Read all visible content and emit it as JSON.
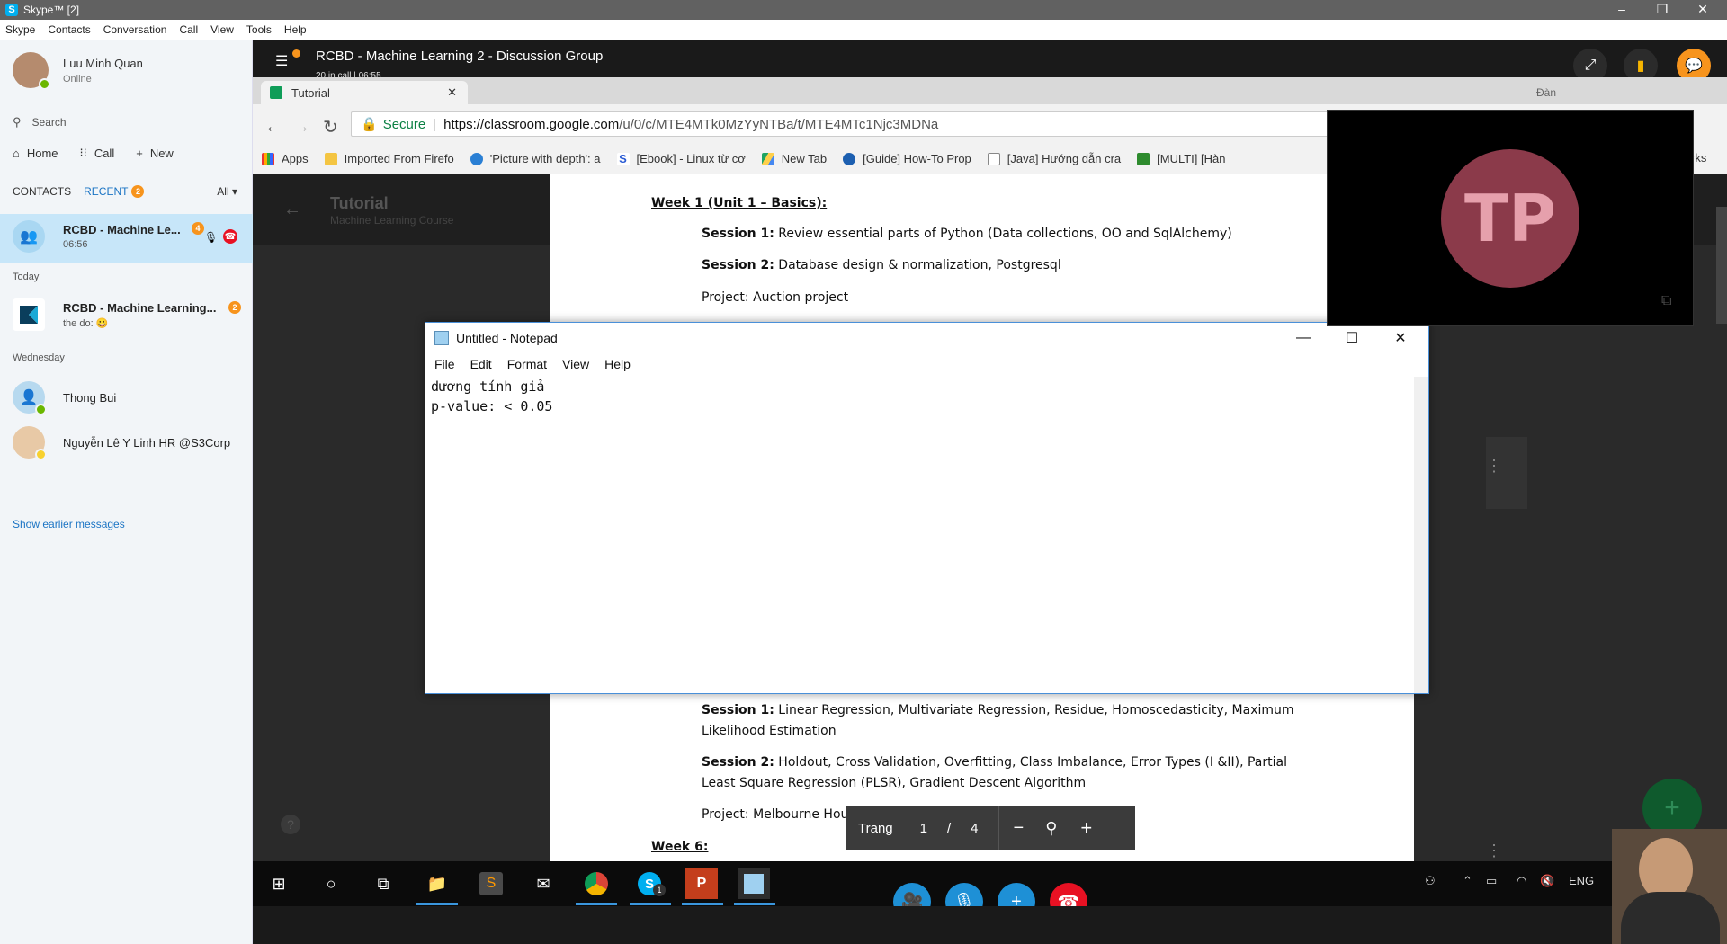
{
  "skype_window": {
    "title": "Skype™ [2]",
    "menu": [
      "Skype",
      "Contacts",
      "Conversation",
      "Call",
      "View",
      "Tools",
      "Help"
    ]
  },
  "profile": {
    "name": "Luu Minh Quan",
    "status": "Online"
  },
  "search": {
    "placeholder": "Search"
  },
  "nav": {
    "home": "Home",
    "call": "Call",
    "new": "New"
  },
  "list_tabs": {
    "contacts": "CONTACTS",
    "recent": "RECENT",
    "recent_badge": "2",
    "filter": "All"
  },
  "active_conversation": {
    "title": "RCBD - Machine Le...",
    "time": "06:56",
    "badge": "4"
  },
  "sections": {
    "today": "Today",
    "wednesday": "Wednesday"
  },
  "conversations": [
    {
      "title": "RCBD - Machine Learning...",
      "subtitle": "the do:",
      "badge": "2"
    },
    {
      "title": "Thong Bui"
    },
    {
      "title": "Nguyễn Lê Y Linh HR @S3Corp"
    }
  ],
  "show_earlier": "Show earlier messages",
  "call": {
    "title": "RCBD - Machine Learning 2 - Discussion Group",
    "subtitle": "20 in call | 06:55"
  },
  "browser": {
    "tab_title": "Tutorial",
    "secure_label": "Secure",
    "url_host": "https://classroom.google.com",
    "url_path": "/u/0/c/MTE4MTk0MzYyNTBa/t/MTE4MTc1Njc3MDNa",
    "bookmarks": [
      "Apps",
      "Imported From Firefo",
      "'Picture with depth': a",
      "[Ebook] - Linux từ cơ",
      "New Tab",
      "[Guide] How-To Prop",
      "[Java] Hướng dẫn cra",
      "[MULTI] [Hàn"
    ],
    "bookmark_right": "rks"
  },
  "classroom": {
    "title": "Tutorial",
    "subtitle": "Machine Learning Course"
  },
  "document": {
    "week1": "Week 1 (Unit 1 – Basics):",
    "s1_label": "Session 1:",
    "s1_text": "Review essential parts of Python (Data collections, OO and SqlAlchemy)",
    "s2_label": "Session 2:",
    "s2_text": "Database design & normalization, Postgresql",
    "project1": "Project: Auction project",
    "w5_s1_label": "Session 1:",
    "w5_s1_text": "Linear Regression, Multivariate Regression, Residue, Homoscedasticity, Maximum",
    "w5_s1_text2": "Likelihood Estimation",
    "w5_s2_label": "Session 2:",
    "w5_s2_text": "Holdout, Cross Validation, Overfitting, Class Imbalance, Error Types (I &II), Partial",
    "w5_s2_text2": "Least Square Regression (PLSR), Gradient Descent Algorithm",
    "project5": "Project: Melbourne Housing",
    "week6": "Week 6:"
  },
  "pdf_toolbar": {
    "page_label": "Trang",
    "current_page": "1",
    "separator": "/",
    "total_pages": "4"
  },
  "notepad": {
    "title": "Untitled - Notepad",
    "menu": [
      "File",
      "Edit",
      "Format",
      "View",
      "Help"
    ],
    "text_line1": "dương tính giả",
    "text_line2": "p-value: < 0.05"
  },
  "video_tile": {
    "initials": "TP"
  },
  "dim_label": "Đàn",
  "taskbar": {
    "language": "ENG",
    "skype_badge": "1"
  },
  "colors": {
    "skype_blue": "#00aff0",
    "active_row": "#c7e6f9",
    "badge_orange": "#f7941d",
    "end_call_red": "#e81123"
  }
}
